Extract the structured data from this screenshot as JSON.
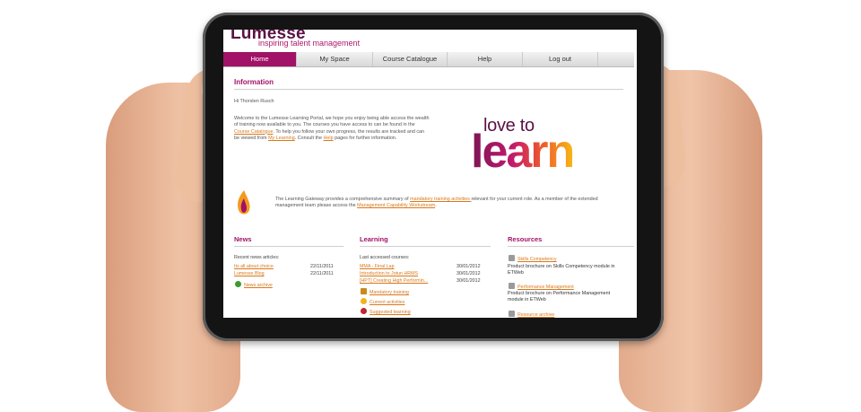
{
  "brand": {
    "name": "Lumesse",
    "tagline": "inspiring talent management"
  },
  "nav": {
    "items": [
      "Home",
      "My Space",
      "Course Catalogue",
      "Help",
      "Log out"
    ],
    "active": "Home"
  },
  "information": {
    "title": "Information",
    "greeting": "Hi Thorsten Rusch",
    "welcome": {
      "p1": "Welcome to the Lumesse Learning Portal, we hope you enjoy being able access the wealth of training now available to you. The courses you have access to can be found in the ",
      "link1": "Course Catalogue",
      "p2": ". To help you follow your own progress, the results are tracked and can be viewed from ",
      "link2": "My Learning",
      "p3": ". Consult the ",
      "link3": "Help",
      "p4": " pages for further information."
    },
    "banner": {
      "line1": "love to",
      "line2": "learn"
    },
    "gateway": {
      "p1": "The Learning Gateway provides a comprehensive summary of ",
      "link1": "mandatory training activities ",
      "p2": "relevant for your current role. As a member of the extended management team please access the ",
      "link2": "Management Capability Workstream",
      "p3": "."
    }
  },
  "news": {
    "title": "News",
    "subtitle": "Recent news articles:",
    "items": [
      {
        "title": "Its all about choice",
        "date": "22/11/2011"
      },
      {
        "title": "Lumesse Blog",
        "date": "22/11/2011"
      }
    ],
    "archive": "News archive"
  },
  "learning": {
    "title": "Learning",
    "subtitle": "Last accessed courses:",
    "courses": [
      {
        "title": "MMA - Final Lap",
        "date": "30/01/2012"
      },
      {
        "title": "Introduction to Jotun HRMS",
        "date": "30/01/2012"
      },
      {
        "title": "[HPT] Creating High Performin...",
        "date": "30/01/2012"
      }
    ],
    "links": [
      "Mandatory training",
      "Current activities",
      "Suggested learning"
    ]
  },
  "resources": {
    "title": "Resources",
    "items": [
      {
        "title": "Skills Competency",
        "desc": "Product brochure on Skills Competency module in ETWeb"
      },
      {
        "title": "Performance Management",
        "desc": "Product brochure on Performance Management module in ETWeb"
      }
    ],
    "archive": "Resource archive"
  },
  "colors": {
    "accent": "#a01366",
    "link": "#d9781b",
    "brand": "#5b1245"
  }
}
